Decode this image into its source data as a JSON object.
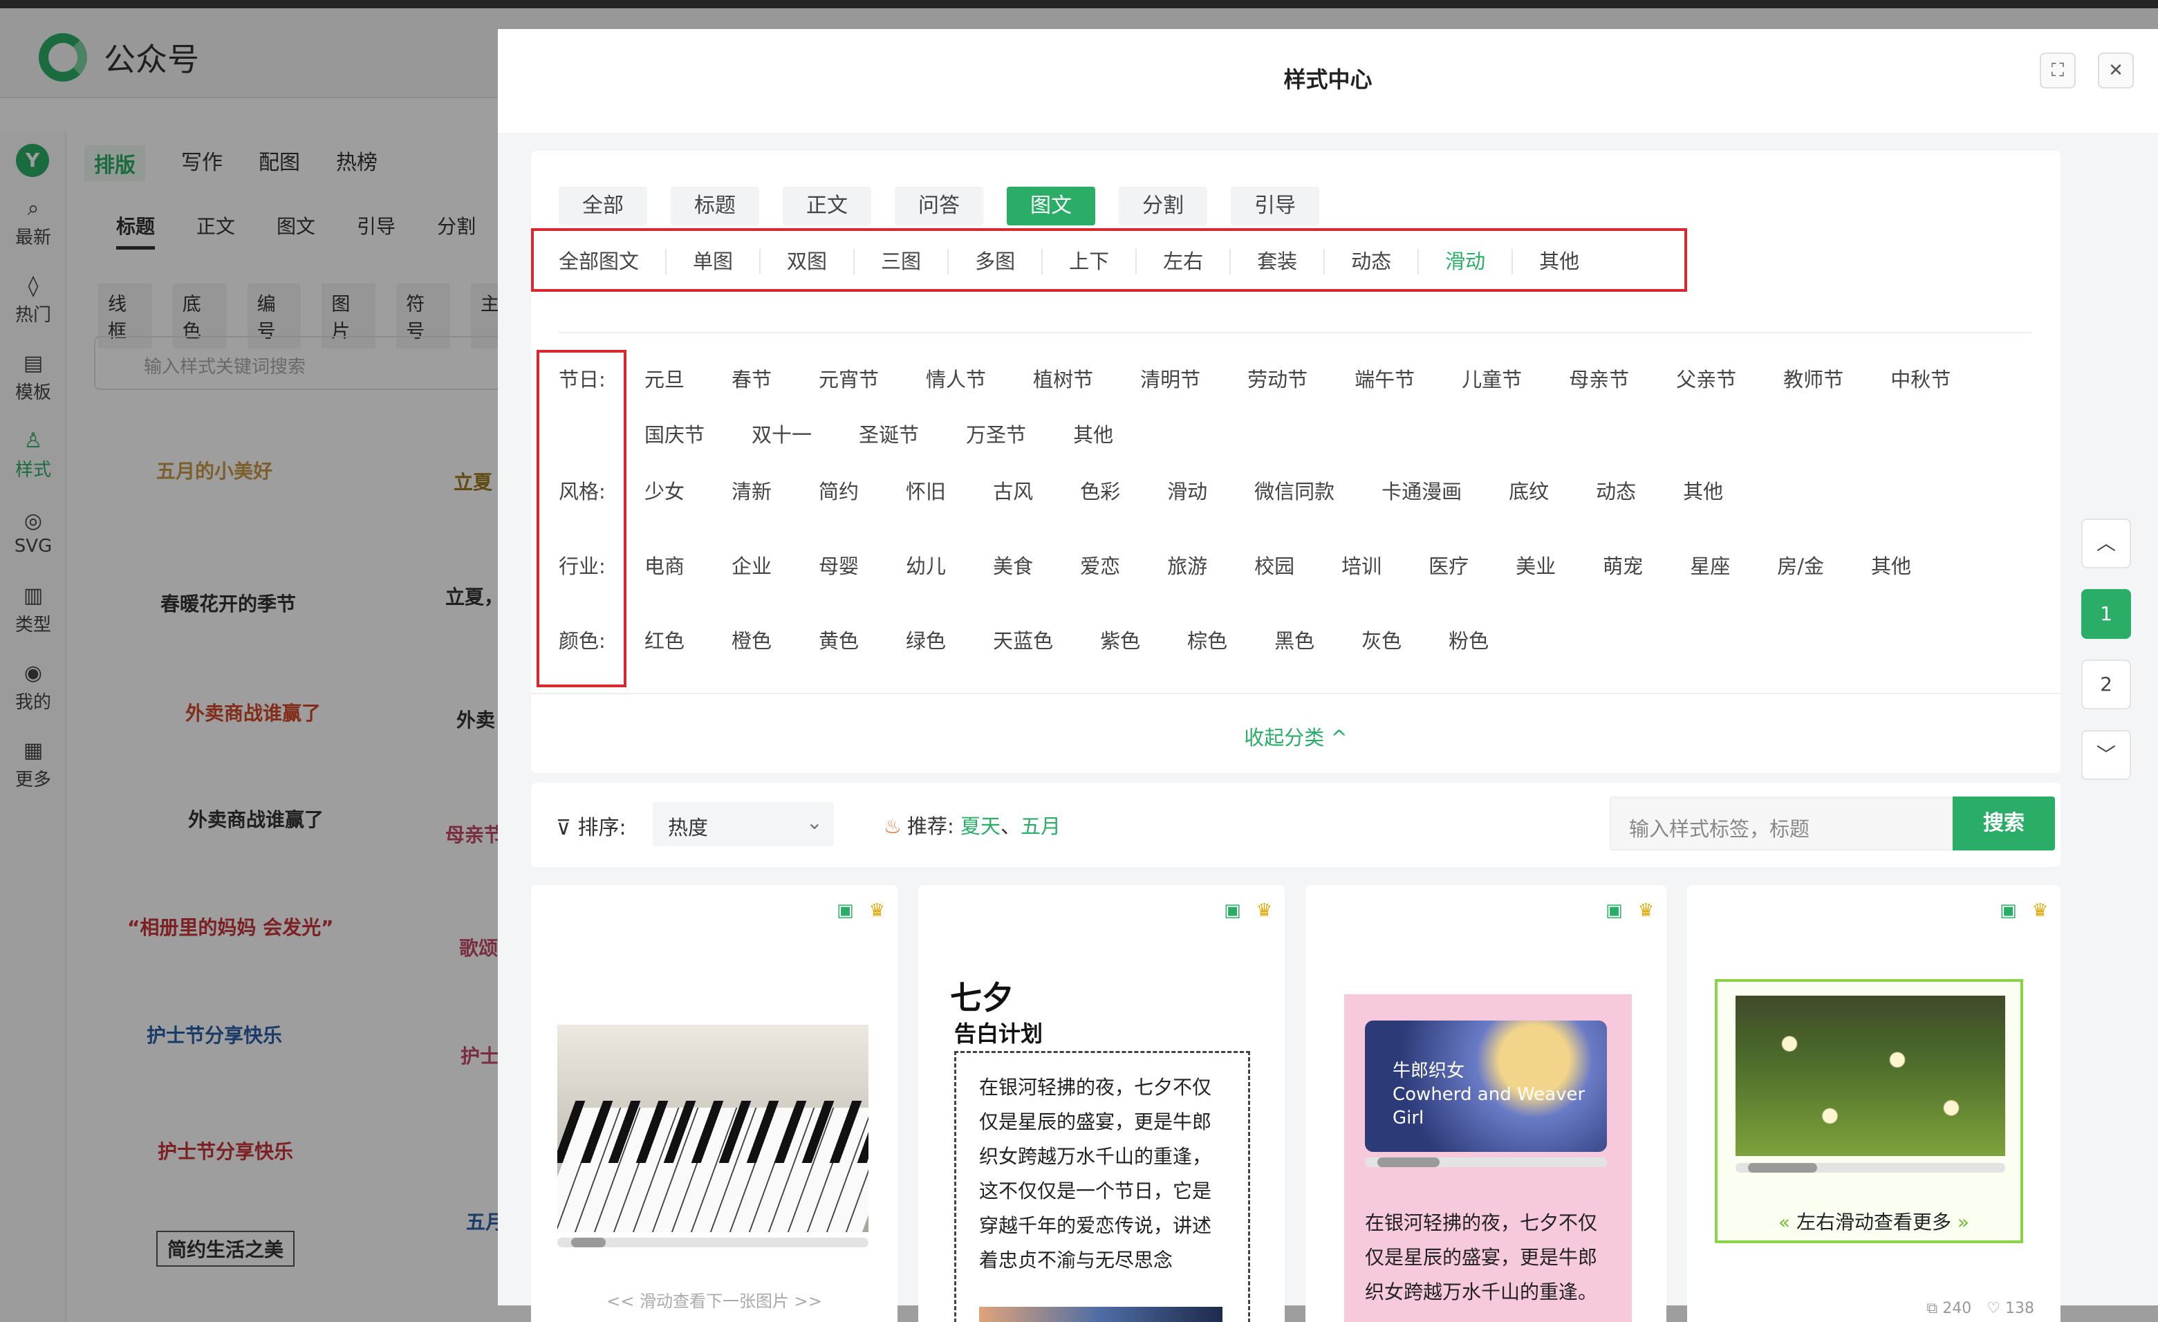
{
  "bg": {
    "app_name": "公众号",
    "left_nav": [
      {
        "icon": "chat-icon",
        "glyph": "⌕",
        "label": "最新"
      },
      {
        "icon": "flame-icon",
        "glyph": "◊",
        "label": "热门"
      },
      {
        "icon": "template-icon",
        "glyph": "▤",
        "label": "模板"
      },
      {
        "icon": "style-icon",
        "glyph": "♙",
        "label": "样式"
      },
      {
        "icon": "svg-icon",
        "glyph": "◎",
        "label": "SVG"
      },
      {
        "icon": "type-icon",
        "glyph": "▥",
        "label": "类型"
      },
      {
        "icon": "user-icon",
        "glyph": "◉",
        "label": "我的"
      },
      {
        "icon": "more-icon",
        "glyph": "▦",
        "label": "更多"
      }
    ],
    "toolbar_tabs": [
      "排版",
      "写作",
      "配图",
      "热榜"
    ],
    "sub_tabs": [
      "标题",
      "正文",
      "图文",
      "引导",
      "分割"
    ],
    "mini_tabs": [
      "线框",
      "底色",
      "编号",
      "图片",
      "符号",
      "主"
    ],
    "search_placeholder": "输入样式关键词搜索",
    "stickers": [
      "五月的小美好",
      "立夏",
      "春暖花开的季节",
      "立夏，",
      "外卖商战谁赢了",
      "外卖",
      "外卖商战谁赢了",
      "母亲节",
      "“相册里的妈妈 会发光”",
      "歌颂",
      "护士节分享快乐",
      "护士",
      "护士节分享快乐",
      "五月",
      "简约生活之美"
    ]
  },
  "modal": {
    "title": "样式中心",
    "main_tabs": [
      {
        "label": "全部",
        "active": false
      },
      {
        "label": "标题",
        "active": false
      },
      {
        "label": "正文",
        "active": false
      },
      {
        "label": "问答",
        "active": false
      },
      {
        "label": "图文",
        "active": true
      },
      {
        "label": "分割",
        "active": false
      },
      {
        "label": "引导",
        "active": false
      }
    ],
    "sub_tabs": [
      {
        "label": "全部图文",
        "active": false
      },
      {
        "label": "单图",
        "active": false
      },
      {
        "label": "双图",
        "active": false
      },
      {
        "label": "三图",
        "active": false
      },
      {
        "label": "多图",
        "active": false
      },
      {
        "label": "上下",
        "active": false
      },
      {
        "label": "左右",
        "active": false
      },
      {
        "label": "套装",
        "active": false
      },
      {
        "label": "动态",
        "active": false
      },
      {
        "label": "滑动",
        "active": true
      },
      {
        "label": "其他",
        "active": false
      }
    ],
    "filters": {
      "holiday": {
        "label": "节日:",
        "items": [
          "元旦",
          "春节",
          "元宵节",
          "情人节",
          "植树节",
          "清明节",
          "劳动节",
          "端午节",
          "儿童节",
          "母亲节",
          "父亲节",
          "教师节",
          "中秋节",
          "国庆节",
          "双十一",
          "圣诞节",
          "万圣节",
          "其他"
        ]
      },
      "style": {
        "label": "风格:",
        "items": [
          "少女",
          "清新",
          "简约",
          "怀旧",
          "古风",
          "色彩",
          "滑动",
          "微信同款",
          "卡通漫画",
          "底纹",
          "动态",
          "其他"
        ]
      },
      "industry": {
        "label": "行业:",
        "items": [
          "电商",
          "企业",
          "母婴",
          "幼儿",
          "美食",
          "爱恋",
          "旅游",
          "校园",
          "培训",
          "医疗",
          "美业",
          "萌宠",
          "星座",
          "房/金",
          "其他"
        ]
      },
      "color": {
        "label": "颜色:",
        "items": [
          "红色",
          "橙色",
          "黄色",
          "绿色",
          "天蓝色",
          "紫色",
          "棕色",
          "黑色",
          "灰色",
          "粉色"
        ]
      }
    },
    "collapse_label": "收起分类 ^",
    "pagination": {
      "up": "︿",
      "pages": [
        "1",
        "2"
      ],
      "active_page": "1",
      "down": "﹀"
    },
    "sort": {
      "label": "排序:",
      "value": "热度",
      "recommend_label": "推荐:",
      "recommend_tags": [
        "夏天",
        "五月"
      ],
      "search_placeholder": "输入样式标签，标题",
      "search_button": "搜索"
    },
    "cards": [
      {
        "type": "piano",
        "hint": "<<  滑动查看下一张图片  >>"
      },
      {
        "type": "qixi",
        "title": "七夕",
        "subtitle": "告白计划",
        "lines": [
          "在银河轻拂的夜，七夕不仅",
          "仅是星辰的盛宴，更是牛郎",
          "织女跨越万水千山的重逢，",
          "这不仅仅是一个节日，它是",
          "穿越千年的爱恋传说，讲述",
          "着忠贞不渝与无尽思念"
        ]
      },
      {
        "type": "cowherd",
        "image_text": [
          "牛郎织女",
          "Cowherd and Weaver",
          "Girl"
        ],
        "lines": [
          "在银河轻拂的夜，七夕不仅",
          "仅是星辰的盛宴，更是牛郎",
          "织女跨越万水千山的重逢。"
        ]
      },
      {
        "type": "flowers",
        "slide_text": "左右滑动查看更多",
        "copies": "240",
        "likes": "138"
      }
    ]
  }
}
